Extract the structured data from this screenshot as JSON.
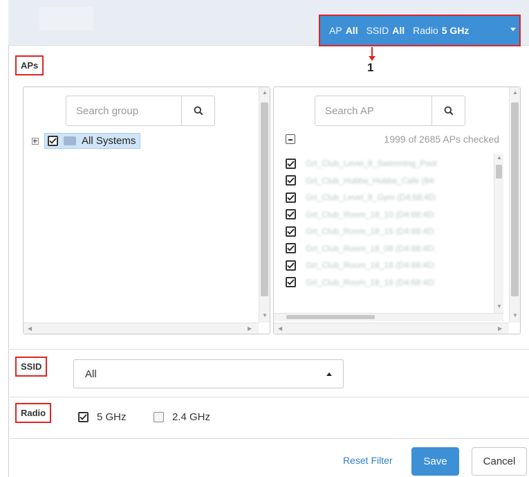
{
  "header": {
    "filter": {
      "ap_label": "AP",
      "ap_value": "All",
      "ssid_label": "SSID",
      "ssid_value": "All",
      "radio_label": "Radio",
      "radio_value": "5 GHz"
    },
    "callout_number": "1"
  },
  "aps_section": {
    "label": "APs",
    "group_search": {
      "placeholder": "Search group"
    },
    "tree": {
      "root_label": "All Systems",
      "checked": true
    },
    "ap_search": {
      "placeholder": "Search AP"
    },
    "ap_count_text": "1999 of 2685 APs checked",
    "ap_items": [
      {
        "name": "Grt_Club_Level_8_Swimming_Pool",
        "checked": true
      },
      {
        "name": "Grt_Club_Hubba_Hubba_Cafe (84:",
        "checked": true
      },
      {
        "name": "Grt_Club_Level_8_Gym (D4:68:4D:",
        "checked": true
      },
      {
        "name": "Grt_Club_Room_18_10 (D4:68:4D:",
        "checked": true
      },
      {
        "name": "Grt_Club_Room_18_15 (D4:68:4D:",
        "checked": true
      },
      {
        "name": "Grt_Club_Room_18_08 (D4:68:4D:",
        "checked": true
      },
      {
        "name": "Grt_Club_Room_18_18 (D4:68:4D:",
        "checked": true
      },
      {
        "name": "Grt_Club_Room_18_16 (D4:68:4D:",
        "checked": true
      }
    ]
  },
  "ssid_section": {
    "label": "SSID",
    "selected": "All"
  },
  "radio_section": {
    "label": "Radio",
    "options": [
      {
        "label": "5 GHz",
        "checked": true
      },
      {
        "label": "2.4 GHz",
        "checked": false
      }
    ]
  },
  "footer": {
    "reset_label": "Reset Filter",
    "save_label": "Save",
    "cancel_label": "Cancel"
  },
  "colors": {
    "accent": "#3d8fd6",
    "callout": "#e02424",
    "link": "#2f7fc8",
    "tree_selection": "#cfe4f7"
  }
}
